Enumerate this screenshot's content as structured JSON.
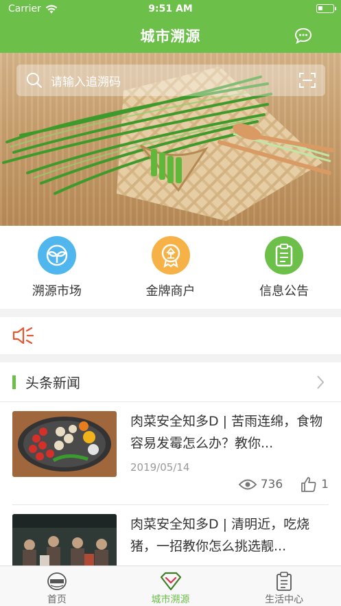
{
  "status": {
    "carrier": "Carrier",
    "time": "9:51 AM"
  },
  "nav": {
    "title": "城市溯源"
  },
  "search": {
    "placeholder": "请输入追溯码"
  },
  "quick": [
    {
      "label": "溯源市场",
      "color": "#4fb6ee"
    },
    {
      "label": "金牌商户",
      "color": "#f6b246"
    },
    {
      "label": "信息公告",
      "color": "#6cc04a"
    }
  ],
  "news_header": "头条新闻",
  "news": [
    {
      "title": "肉菜安全知多D | 苦雨连绵，食物容易发霉怎么办？教你...",
      "date": "2019/05/14",
      "views": "736",
      "likes": "1"
    },
    {
      "title": "肉菜安全知多D | 清明近，吃烧猪，一招教你怎么挑选靓...",
      "date": "",
      "views": "",
      "likes": ""
    }
  ],
  "tabs": [
    {
      "label": "首页"
    },
    {
      "label": "城市溯源"
    },
    {
      "label": "生活中心"
    }
  ],
  "colors": {
    "accent": "#6cc04a",
    "notice": "#e8552d"
  }
}
